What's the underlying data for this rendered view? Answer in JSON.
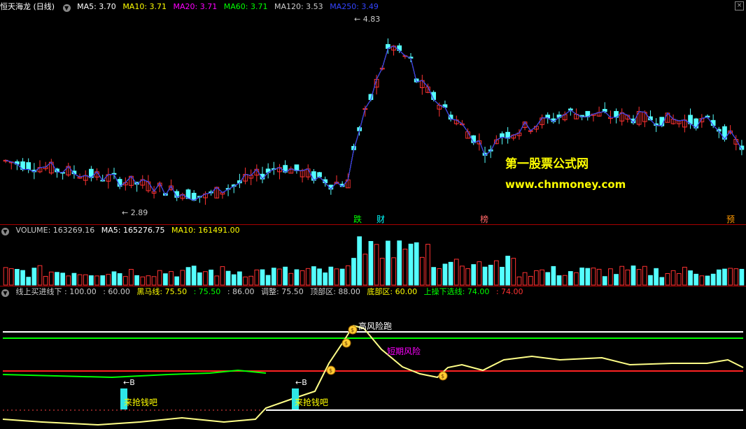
{
  "header": {
    "title": "恒天海龙 (日线)",
    "ma": [
      {
        "label": "MA5: 3.70",
        "color": "#ffffff"
      },
      {
        "label": "MA10: 3.71",
        "color": "#ffff00"
      },
      {
        "label": "MA20: 3.71",
        "color": "#ff00ff"
      },
      {
        "label": "MA60: 3.71",
        "color": "#00ff00"
      },
      {
        "label": "MA120: 3.53",
        "color": "#cccccc"
      },
      {
        "label": "MA250: 3.49",
        "color": "#2222ff"
      }
    ]
  },
  "volume_header": {
    "title": "VOLUME: 163269.16",
    "ma5": "MA5: 165276.75",
    "ma10": "MA10: 161491.00"
  },
  "indicator_header": {
    "items": [
      {
        "label": "线上买进线下 : 100.00",
        "color": "#cccccc"
      },
      {
        "label": ": 60.00",
        "color": "#cccccc"
      },
      {
        "label": "黑马线: 75.50",
        "color": "#ffff00"
      },
      {
        "label": ": 75.50",
        "color": "#00ff00"
      },
      {
        "label": ": 86.00",
        "color": "#cccccc"
      },
      {
        "label": "调整: 75.50",
        "color": "#cccccc"
      },
      {
        "label": "顶部区: 88.00",
        "color": "#cccccc"
      },
      {
        "label": "底部区: 60.00",
        "color": "#ffff00"
      },
      {
        "label": "上操下选线: 74.00",
        "color": "#00ff00"
      },
      {
        "label": ": 74.00",
        "color": "#ff3333"
      }
    ]
  },
  "watermark": {
    "line1": "第一股票公式网",
    "line2": "www.chnmoney.com"
  },
  "markers": [
    {
      "text": "跌",
      "color": "#00ff00"
    },
    {
      "text": "财",
      "color": "#00ffff"
    },
    {
      "text": "榜",
      "color": "#ff6666"
    },
    {
      "text": "预",
      "color": "#ff9900"
    }
  ],
  "annotations": {
    "high": "4.83",
    "low": "2.89",
    "risk_high": "高风险跑",
    "risk_short": "短期风险",
    "buy1": "来抢钱吧",
    "buy2": "来抢钱吧",
    "b_label": "←B"
  },
  "chart_data": {
    "type": "candlestick",
    "candles_count": 130,
    "price_range": [
      2.89,
      4.83
    ],
    "indicator_levels": {
      "top": 88.0,
      "bottom": 60.0,
      "mid": 74.0
    }
  }
}
